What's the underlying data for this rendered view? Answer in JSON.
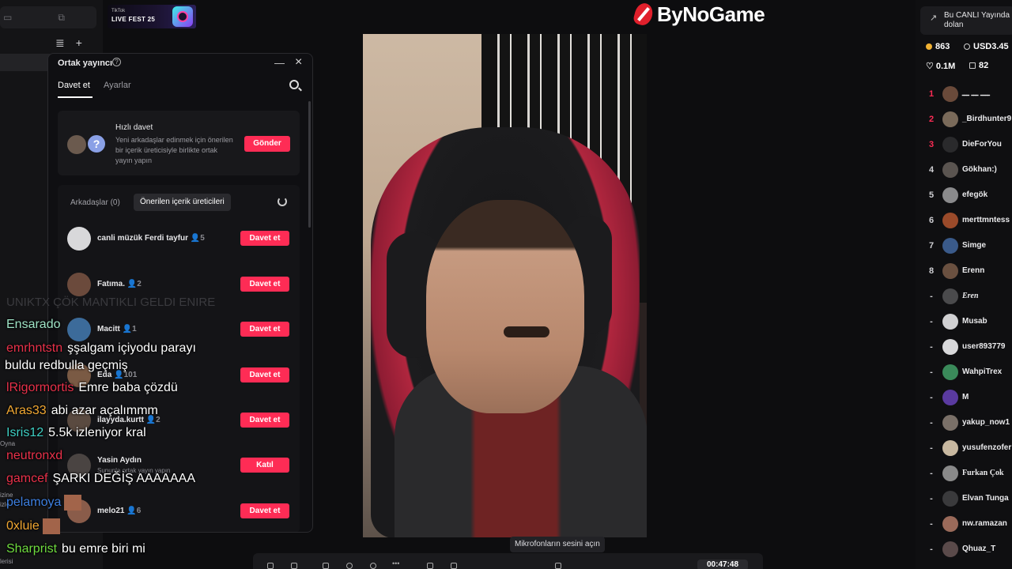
{
  "badge": {
    "small": "TikTok",
    "title": "LIVE FEST 25"
  },
  "logo": {
    "text": "ByNoGame"
  },
  "left_rail": {
    "labels": [
      "Oyna",
      "izine",
      "izle",
      "lerisi"
    ]
  },
  "panel": {
    "title": "Ortak yayıncı",
    "tabs": [
      "Davet et",
      "Ayarlar"
    ],
    "quick": {
      "title": "Hızlı davet",
      "desc": "Yeni arkadaşlar edinmek için önerilen bir içerik üreticisiyle birlikte ortak yayın yapın",
      "button": "Gönder"
    },
    "filter_tabs": [
      "Arkadaşlar (0)",
      "Önerilen içerik üreticileri"
    ],
    "rows": [
      {
        "name": "canli müzük Ferdi tayfur",
        "count": "5",
        "sub": "",
        "button": "Davet et"
      },
      {
        "name": "Fatıma.",
        "count": "2",
        "sub": "",
        "button": "Davet et"
      },
      {
        "name": "Macitt",
        "count": "1",
        "sub": "",
        "button": "Davet et"
      },
      {
        "name": "Eda",
        "count": "101",
        "sub": "",
        "button": "Davet et"
      },
      {
        "name": "ilayyda.kurtt",
        "count": "2",
        "sub": "",
        "button": "Davet et"
      },
      {
        "name": "Yasin Aydın",
        "count": "",
        "sub": "Sununla ortak yayın yapın",
        "button": "Katıl"
      },
      {
        "name": "melo21",
        "count": "6",
        "sub": "",
        "button": "Davet et"
      }
    ]
  },
  "chat": {
    "ghost": "UNIKTX ÇÖK MANTIKLI GELDI ENIRE",
    "lines": [
      {
        "user": "Ensarado",
        "msg": "",
        "color": "#9de2c4"
      },
      {
        "user": "emrhntstn",
        "msg": "şşalgam içiyodu parayı",
        "color": "#e8314a"
      },
      {
        "user": "",
        "msg": "buldu redbulla geçmiş",
        "color": "#ffffff"
      },
      {
        "user": "lRigormortis",
        "msg": "Emre baba çözdü",
        "color": "#e8314a"
      },
      {
        "user": "Aras33",
        "msg": "abi azar açalımmm",
        "color": "#f0a732"
      },
      {
        "user": "Isris12",
        "msg": "5.5k izleniyor kral",
        "color": "#3ecfc4"
      },
      {
        "user": "neutronxd",
        "msg": "",
        "color": "#e8314a"
      },
      {
        "user": "gamcef",
        "msg": "ŞARKI DEĞİŞ AAAAAAA",
        "color": "#e8314a"
      },
      {
        "user": "pelamoya",
        "msg": "",
        "color": "#3d7fe0"
      },
      {
        "user": "0xluie",
        "msg": "",
        "color": "#f0a732"
      },
      {
        "user": "Sharprist",
        "msg": "bu emre biri mi",
        "color": "#6fdc3f"
      }
    ]
  },
  "tooltip": "Mikrofonların sesini açın",
  "timer": "00:47:48",
  "right": {
    "live_text": "Bu CANLI Yayında dolan",
    "stats": {
      "diamonds": "863",
      "usd": "USD3.45",
      "likes": "0.1M",
      "gifts": "82"
    },
    "viewers": [
      {
        "rank": "1",
        "name": "ــــ ـــ ـــ"
      },
      {
        "rank": "2",
        "name": "_Birdhunter9"
      },
      {
        "rank": "3",
        "name": "DieForYou"
      },
      {
        "rank": "4",
        "name": "Gökhan:)"
      },
      {
        "rank": "5",
        "name": "efegök"
      },
      {
        "rank": "6",
        "name": "merttmntess"
      },
      {
        "rank": "7",
        "name": "Simge"
      },
      {
        "rank": "8",
        "name": "Erenn"
      },
      {
        "rank": "-",
        "name": "Eren"
      },
      {
        "rank": "-",
        "name": "Musab"
      },
      {
        "rank": "-",
        "name": "user893779"
      },
      {
        "rank": "-",
        "name": "WahpiTrex"
      },
      {
        "rank": "-",
        "name": "M"
      },
      {
        "rank": "-",
        "name": "yakup_now1"
      },
      {
        "rank": "-",
        "name": "yusufenzofer"
      },
      {
        "rank": "-",
        "name": "Furkan Çok"
      },
      {
        "rank": "-",
        "name": "Elvan Tunga"
      },
      {
        "rank": "-",
        "name": "nw.ramazan"
      },
      {
        "rank": "-",
        "name": "Qhuaz_T"
      }
    ]
  }
}
